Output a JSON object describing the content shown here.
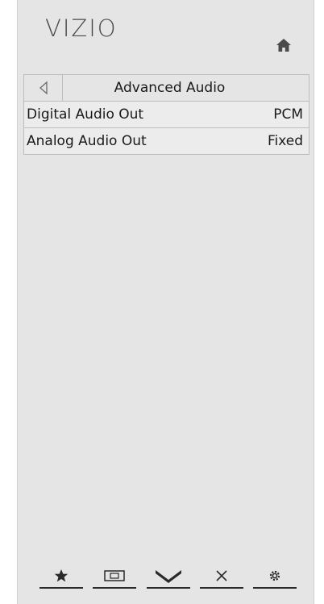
{
  "brand": {
    "logo_text": "VIZIO"
  },
  "menu": {
    "title": "Advanced Audio",
    "items": [
      {
        "label": "Digital Audio Out",
        "value": "PCM"
      },
      {
        "label": "Analog Audio Out",
        "value": "Fixed"
      }
    ]
  },
  "icons": {
    "home": "home-icon",
    "back": "back-arrow-icon",
    "bottom_bar": [
      "star-icon",
      "widescreen-icon",
      "vizio-v-icon",
      "close-icon",
      "gear-icon"
    ]
  },
  "colors": {
    "panel_background": "#e5e5e5",
    "text": "#1a1a1a",
    "border": "#bdbdbd"
  }
}
